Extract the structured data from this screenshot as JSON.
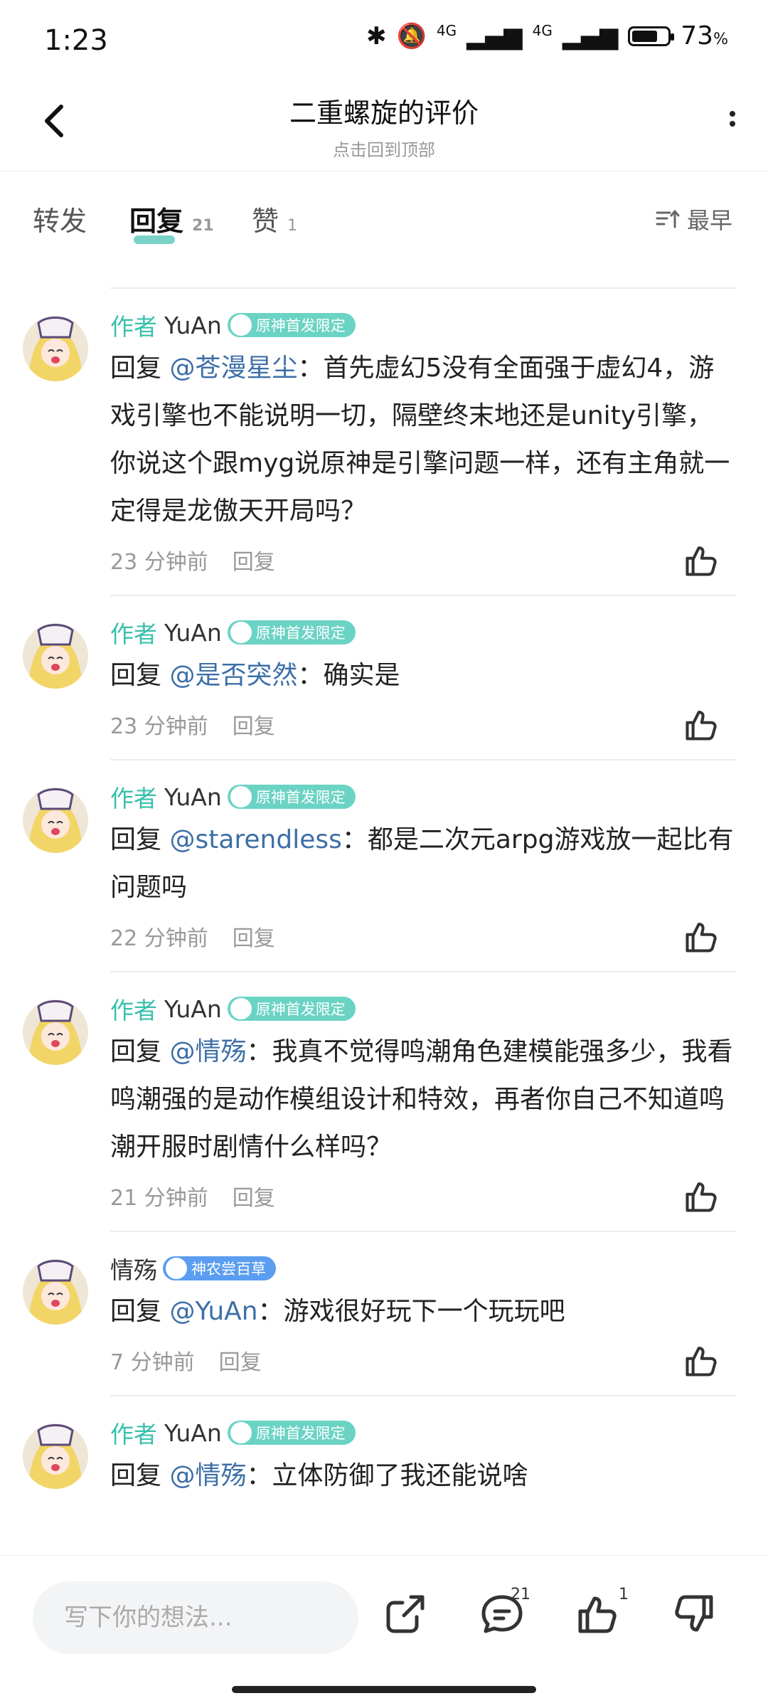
{
  "status": {
    "time": "1:23",
    "battery": "73",
    "battery_unit": "%",
    "battery_level": 0.73,
    "net1": "4G",
    "net2": "4G"
  },
  "header": {
    "title": "二重螺旋的评价",
    "subtitle": "点击回到顶部"
  },
  "tabs": [
    {
      "label": "转发",
      "count": ""
    },
    {
      "label": "回复",
      "count": "21"
    },
    {
      "label": "赞",
      "count": "1"
    }
  ],
  "sort_label": "最早",
  "comments": [
    {
      "tag": "作者",
      "name": "YuAn",
      "badge": "原神首发限定",
      "reply_prefix": "回复 ",
      "mention": "@苍漫星尘",
      "text": "：首先虚幻5没有全面强于虚幻4，游戏引擎也不能说明一切，隔壁终末地还是unity引擎，你说这个跟myg说原神是引擎问题一样，还有主角就一定得是龙傲天开局吗？",
      "time": "23 分钟前",
      "reply": "回复"
    },
    {
      "tag": "作者",
      "name": "YuAn",
      "badge": "原神首发限定",
      "reply_prefix": "回复 ",
      "mention": "@是否突然",
      "text": "：确实是",
      "time": "23 分钟前",
      "reply": "回复"
    },
    {
      "tag": "作者",
      "name": "YuAn",
      "badge": "原神首发限定",
      "reply_prefix": "回复 ",
      "mention": "@starendless",
      "text": "：都是二次元arpg游戏放一起比有问题吗",
      "time": "22 分钟前",
      "reply": "回复"
    },
    {
      "tag": "作者",
      "name": "YuAn",
      "badge": "原神首发限定",
      "reply_prefix": "回复 ",
      "mention": "@情殇",
      "text": "：我真不觉得鸣潮角色建模能强多少，我看鸣潮强的是动作模组设计和特效，再者你自己不知道鸣潮开服时剧情什么样吗？",
      "time": "21 分钟前",
      "reply": "回复"
    },
    {
      "tag": "",
      "name": "情殇",
      "badge": "神农尝百草",
      "reply_prefix": "回复 ",
      "mention": "@YuAn",
      "text": "：游戏很好玩下一个玩玩吧",
      "time": "7 分钟前",
      "reply": "回复"
    },
    {
      "tag": "作者",
      "name": "YuAn",
      "badge": "原神首发限定",
      "reply_prefix": "回复 ",
      "mention": "@情殇",
      "text": "：立体防御了我还能说啥",
      "time": "",
      "reply": ""
    }
  ],
  "bottom": {
    "placeholder": "写下你的想法...",
    "comment_count": "21",
    "like_count": "1"
  },
  "colors": {
    "accent": "#38c0ad",
    "mention": "#3d6fa8",
    "badge_teal": "#6bd3c4",
    "badge_blue": "#5b9df0"
  }
}
